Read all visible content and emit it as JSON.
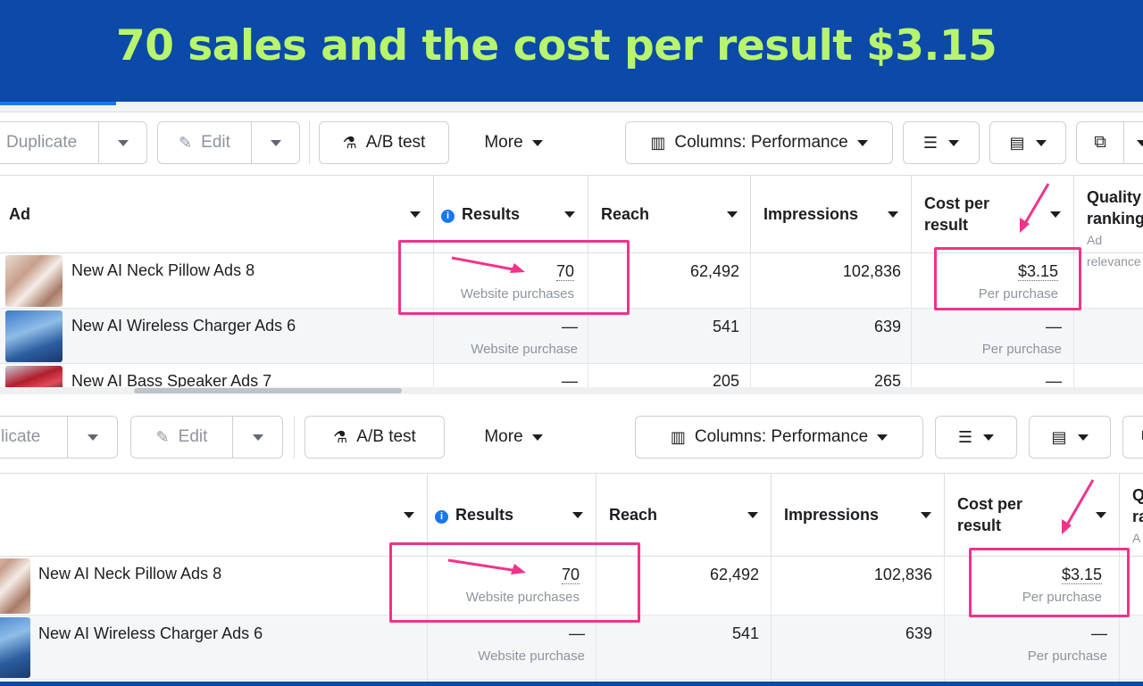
{
  "banner": {
    "title": "70 sales and the cost per result $3.15"
  },
  "colors": {
    "banner_bg": "#0b4aa8",
    "banner_text": "#b8f56d",
    "highlight": "#f0338a",
    "info_blue": "#1877f2"
  },
  "toolbar": {
    "duplicate_label": "Duplicate",
    "duplicate_label_cropped": "licate",
    "edit_label": "Edit",
    "ab_test_label": "A/B test",
    "more_label": "More",
    "columns_label": "Columns: Performance",
    "icons": [
      "pencil-icon",
      "flask-icon",
      "columns-icon",
      "breakdown-icon",
      "reports-icon",
      "export-icon",
      "caret-down-icon"
    ]
  },
  "table": {
    "headers": {
      "ad": "Ad",
      "results": "Results",
      "reach": "Reach",
      "impressions": "Impressions",
      "cost_per_result": "Cost per result",
      "quality_ranking": "Quality ranking",
      "quality_ranking_cropped_top": "Q",
      "quality_ranking_cropped_bottom": "ra",
      "ad_relevance": "Ad relevance",
      "ad_relevance_cropped": "A"
    },
    "rows": [
      {
        "name": "New AI Neck Pillow Ads 8",
        "results": "70",
        "results_sub": "Website purchases",
        "reach": "62,492",
        "impressions": "102,836",
        "cost": "$3.15",
        "cost_sub": "Per purchase"
      },
      {
        "name": "New AI Wireless Charger Ads 6",
        "results": "—",
        "results_sub": "Website purchase",
        "reach": "541",
        "impressions": "639",
        "cost": "—",
        "cost_sub": "Per purchase"
      },
      {
        "name": "New AI Bass Speaker Ads 7",
        "results": "—",
        "results_sub": "",
        "reach": "205",
        "impressions": "265",
        "cost": "—",
        "cost_sub": ""
      }
    ]
  }
}
